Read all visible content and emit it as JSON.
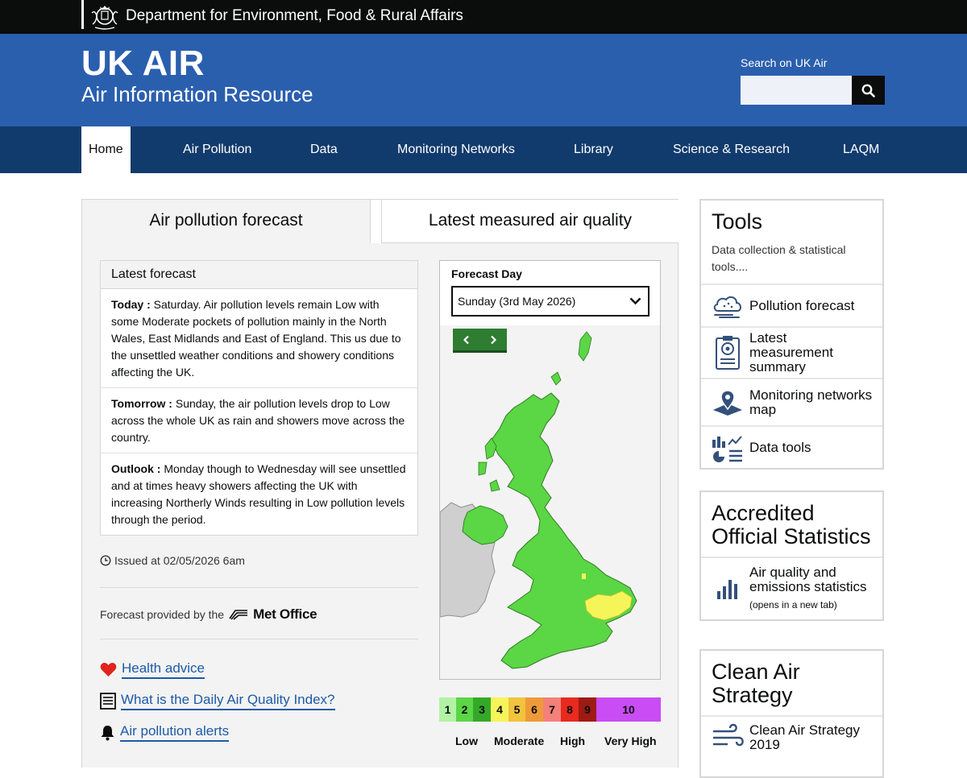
{
  "header": {
    "department": "Department for Environment, Food & Rural Affairs",
    "title": "UK AIR",
    "subtitle": "Air Information Resource",
    "search_label": "Search on UK Air",
    "search_placeholder": ""
  },
  "nav": {
    "items": [
      {
        "label": "Home",
        "active": true
      },
      {
        "label": "Air Pollution"
      },
      {
        "label": "Data"
      },
      {
        "label": "Monitoring Networks"
      },
      {
        "label": "Library"
      },
      {
        "label": "Science & Research"
      },
      {
        "label": "LAQM"
      }
    ]
  },
  "tabs": {
    "forecast": "Air pollution forecast",
    "latest": "Latest measured air quality"
  },
  "forecast": {
    "heading": "Latest forecast",
    "today_label": "Today :",
    "today_text": " Saturday. Air pollution levels remain Low with some Moderate pockets of pollution mainly in the North Wales, East Midlands and East of England. This us due to the unsettled weather conditions and showery conditions affecting the UK.",
    "tomorrow_label": "Tomorrow :",
    "tomorrow_text": " Sunday, the air pollution levels drop to Low across the whole UK as rain and showers move across the country.",
    "outlook_label": "Outlook :",
    "outlook_text": " Monday though to Wednesday will see unsettled and at times heavy showers affecting the UK with increasing Northerly Winds resulting in Low pollution levels through the period.",
    "issued": "Issued at 02/05/2026 6am",
    "provided_by": "Forecast provided by the",
    "provider": "Met Office"
  },
  "links": {
    "health": "Health advice",
    "daqi": "What is the Daily Air Quality Index?",
    "alerts": "Air pollution alerts"
  },
  "map": {
    "forecast_day_label": "Forecast Day",
    "selected_day": "Sunday (3rd May 2026)"
  },
  "legend": {
    "bands": [
      {
        "value": "1",
        "color": "#b3f2a5"
      },
      {
        "value": "2",
        "color": "#5bd645"
      },
      {
        "value": "3",
        "color": "#35a82a"
      },
      {
        "value": "4",
        "color": "#f5f55a"
      },
      {
        "value": "5",
        "color": "#f2c33d"
      },
      {
        "value": "6",
        "color": "#ef9a3a"
      },
      {
        "value": "7",
        "color": "#f4807a"
      },
      {
        "value": "8",
        "color": "#e82a1f"
      },
      {
        "value": "9",
        "color": "#9d1b13"
      },
      {
        "value": "10",
        "color": "#c94cf5"
      }
    ],
    "low": "Low",
    "moderate": "Moderate",
    "high": "High",
    "very_high": "Very High"
  },
  "tools": {
    "title": "Tools",
    "subtitle": "Data collection & statistical tools....",
    "items": [
      {
        "label": "Pollution forecast",
        "icon": "cloud-icon"
      },
      {
        "label": "Latest measurement summary",
        "icon": "clipboard-icon"
      },
      {
        "label": "Monitoring networks map",
        "icon": "map-pin-icon"
      },
      {
        "label": "Data tools",
        "icon": "chart-tools-icon"
      }
    ]
  },
  "stats": {
    "title": "Accredited Official Statistics",
    "item_label": "Air quality and emissions statistics",
    "item_note": "(opens in a new tab)"
  },
  "clean_air": {
    "title": "Clean Air Strategy",
    "item_label": "Clean Air Strategy 2019"
  },
  "colors": {
    "brand_blue": "#2a5fae",
    "nav_blue": "#123b6d",
    "link_blue": "#1d5aa6",
    "map_low_green": "#5bd645",
    "map_moderate_yellow": "#f5f55a"
  }
}
